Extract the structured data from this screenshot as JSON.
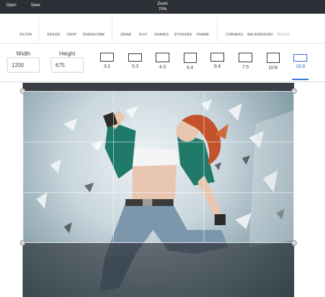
{
  "topbar": {
    "open_label": "Open",
    "save_label": "Save",
    "zoom_label": "Zoom",
    "zoom_value": "70%"
  },
  "menu": {
    "filter": "FILTER",
    "resize": "RESIZE",
    "crop": "CROP",
    "transform": "TRANSFORM",
    "draw": "DRAW",
    "text": "TEXT",
    "shapes": "SHAPES",
    "stickers": "STICKERS",
    "frame": "FRAME",
    "corners": "CORNERS",
    "background": "BACKGROUND",
    "merge": "MERGE"
  },
  "size": {
    "width_label": "Width",
    "width_value": "1200",
    "height_label": "Height",
    "height_value": "675"
  },
  "ratios": [
    {
      "label": "3:2"
    },
    {
      "label": "5:3"
    },
    {
      "label": "4:3"
    },
    {
      "label": "5:4"
    },
    {
      "label": "6:4"
    },
    {
      "label": "7:5"
    },
    {
      "label": "10:8"
    },
    {
      "label": "16:9"
    }
  ],
  "active_ratio": "16:9",
  "colors": {
    "accent": "#2f6fd6",
    "topbar": "#2d2f36"
  }
}
